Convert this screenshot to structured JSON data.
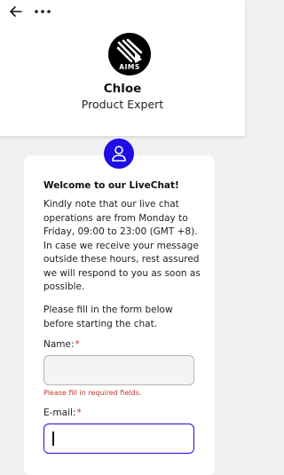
{
  "header": {
    "agent_name": "Chloe",
    "agent_role": "Product Expert",
    "logo_text": "AIMS",
    "back_icon": "arrow-left-icon",
    "menu_icon": "more-horizontal-icon"
  },
  "card": {
    "welcome_title": "Welcome to our LiveChat!",
    "notice": "Kindly note that our live chat operations are from Monday to Friday, 09:00 to 23:00 (GMT +8). In case we receive your message outside these hours, rest assured we will respond to you as soon as possible.",
    "instruction": "Please fill in the form below before starting the chat.",
    "form": {
      "name_label": "Name:",
      "name_value": "",
      "error_message": "Please fill in required fields.",
      "email_label": "E-mail:",
      "email_value": "",
      "required_marker": "*"
    }
  },
  "colors": {
    "accent": "#1d0ce6",
    "error": "#c0392b",
    "background": "#f0f0f1"
  }
}
